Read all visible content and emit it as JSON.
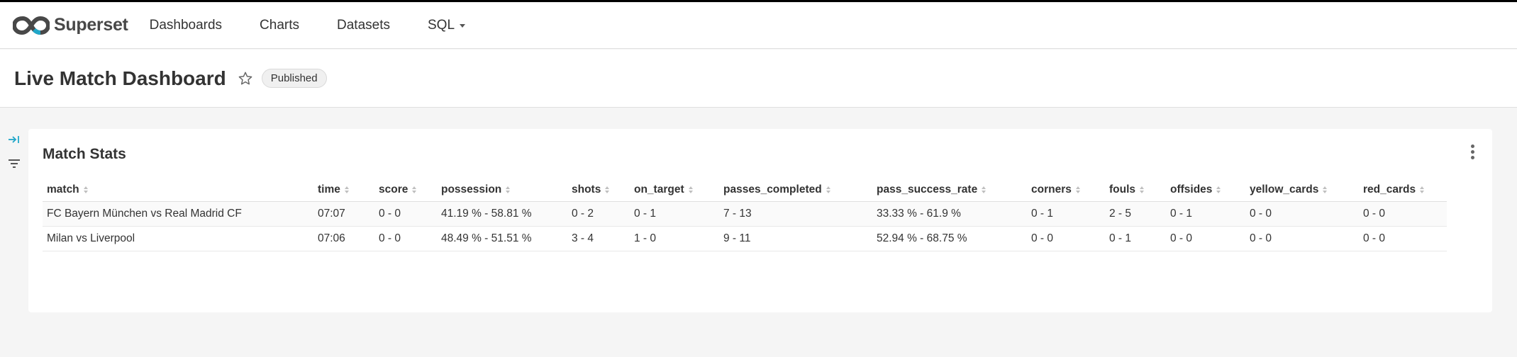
{
  "app": {
    "name": "Superset"
  },
  "nav": {
    "items": [
      {
        "label": "Dashboards"
      },
      {
        "label": "Charts"
      },
      {
        "label": "Datasets"
      },
      {
        "label": "SQL",
        "dropdown": true
      }
    ]
  },
  "header": {
    "title": "Live Match Dashboard",
    "status": "Published"
  },
  "chart": {
    "title": "Match Stats",
    "columns": [
      "match",
      "time",
      "score",
      "possession",
      "shots",
      "on_target",
      "passes_completed",
      "pass_success_rate",
      "corners",
      "fouls",
      "offsides",
      "yellow_cards",
      "red_cards"
    ],
    "rows": [
      [
        "FC Bayern München vs Real Madrid CF",
        "07:07",
        "0 - 0",
        "41.19 % - 58.81 %",
        "0 - 2",
        "0 - 1",
        "7 - 13",
        "33.33 % - 61.9 %",
        "0 - 1",
        "2 - 5",
        "0 - 1",
        "0 - 0",
        "0 - 0"
      ],
      [
        "Milan vs Liverpool",
        "07:06",
        "0 - 0",
        "48.49 % - 51.51 %",
        "3 - 4",
        "1 - 0",
        "9 - 11",
        "52.94 % - 68.75 %",
        "0 - 0",
        "0 - 1",
        "0 - 0",
        "0 - 0",
        "0 - 0"
      ]
    ]
  },
  "colors": {
    "accent": "#20a7c9",
    "brand_dark": "#484848"
  },
  "icons": {
    "logo": "superset-logo-icon",
    "favorite": "star-icon",
    "expand": "expand-filters-icon",
    "filter": "filter-icon",
    "menu": "more-vertical-icon",
    "sort": "sort-icon"
  }
}
